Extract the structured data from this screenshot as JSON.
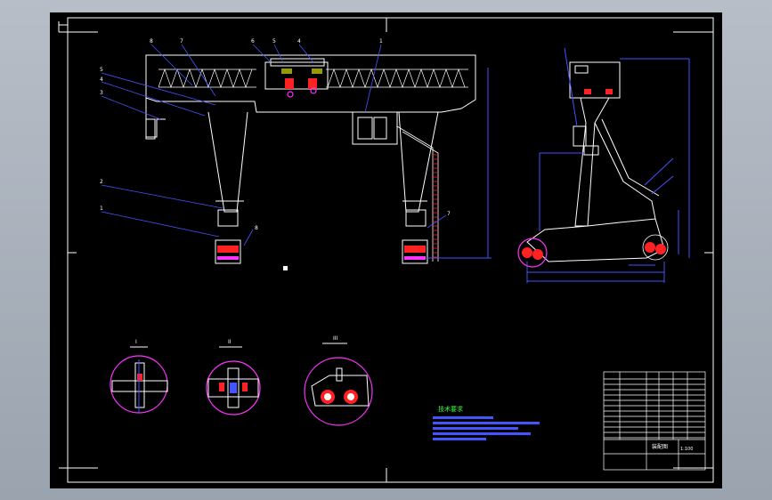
{
  "colors": {
    "page_bg": "#a5adb8",
    "sheet": "#000000",
    "frame": "#ffffff",
    "dim_line": "#4455ff",
    "red": "#ff2222",
    "magenta": "#ff33ff",
    "cyan": "#00e5ff",
    "yellow": "#ffff00",
    "green": "#33ff33"
  },
  "views": {
    "front_elevation": "gantry-crane-front-view",
    "side_elevation": "gantry-crane-side-view",
    "detail_1": {
      "label": "I"
    },
    "detail_2": {
      "label": "II"
    },
    "detail_3": {
      "label": "III"
    }
  },
  "notes": {
    "title": "技术要求"
  },
  "title_block": {
    "drawing_name": "装配图",
    "scale": "1:100"
  }
}
